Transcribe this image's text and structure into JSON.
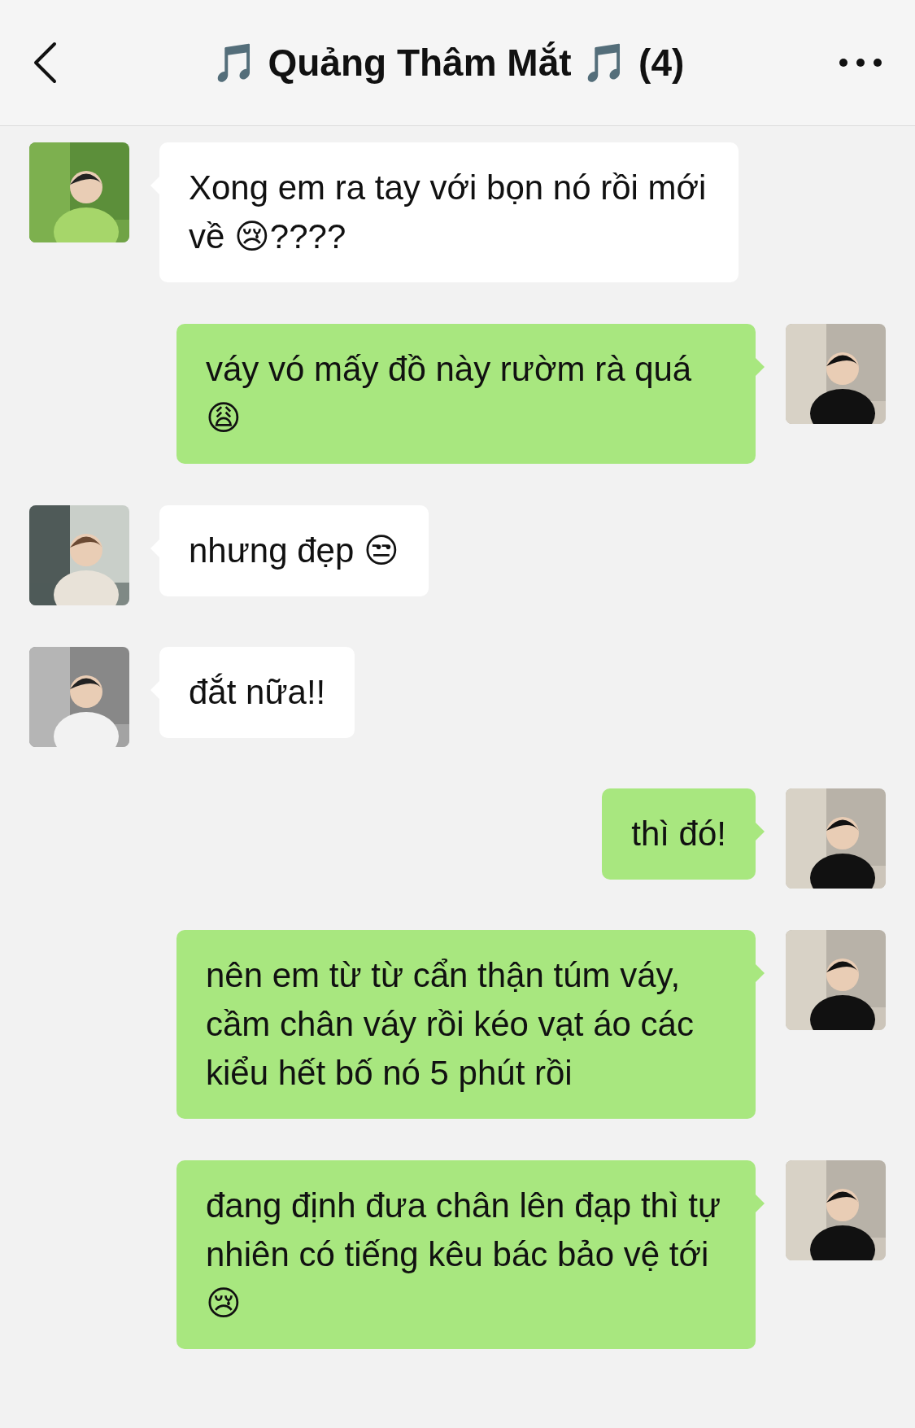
{
  "header": {
    "title": "🎵 Quảng Thâm Mắt 🎵 (4)"
  },
  "messages": [
    {
      "kind": "incoming",
      "text": "Xong em ra tay với bọn nó rồi mới về 😢????"
    },
    {
      "kind": "outgoing",
      "text": "váy vó mấy đồ này rườm rà quá 😩"
    },
    {
      "kind": "incoming",
      "text": "nhưng đẹp 😒"
    },
    {
      "kind": "incoming",
      "text": "đắt nữa!!"
    },
    {
      "kind": "outgoing",
      "text": "thì đó!"
    },
    {
      "kind": "outgoing",
      "text": "nên em từ từ cẩn thận túm váy, cầm chân váy rồi kéo vạt áo các kiểu hết bố nó 5 phút rồi"
    },
    {
      "kind": "outgoing",
      "text": "đang định đưa chân lên đạp thì tự nhiên có tiếng kêu bác bảo vệ tới 😢"
    }
  ]
}
